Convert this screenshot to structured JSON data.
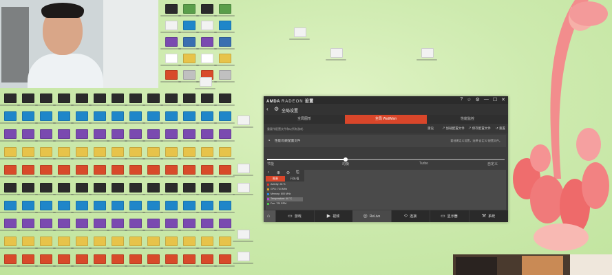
{
  "window": {
    "brand": "AMDA",
    "brand_sub": "RADEON",
    "title_suffix": "设置",
    "controls": [
      "?",
      "☆",
      "⚙",
      "—",
      "☐",
      "✕"
    ],
    "header_title": "全局设置"
  },
  "tabs": [
    "全局图形",
    "全局 WattMan",
    "性能监控"
  ],
  "options": {
    "hint": "重要作配置文件和以所有游戏.",
    "reset": "重设",
    "load": "加载配置文件",
    "save": "保存配置文件",
    "restore": "重置"
  },
  "profile": {
    "label": "性能/功耗配置文件",
    "note": "要创建定义设置，选择“自定义”配置文件。"
  },
  "slider": {
    "ticks": [
      "节能",
      "均衡",
      "Turbo",
      "自定义"
    ],
    "level": 0.33
  },
  "graph": {
    "tabs": [
      "图表",
      "开关/值"
    ],
    "legend": [
      {
        "label": "Activity: 28 %",
        "color": "#e03a2a"
      },
      {
        "label": "GPU: 744 MHz",
        "color": "#e0a22a"
      },
      {
        "label": "Memory: 800 MHz",
        "color": "#2a8ae0"
      },
      {
        "label": "Temperature: 40 °C",
        "color": "#b04ad0"
      },
      {
        "label": "Fan: 720 RPM",
        "color": "#4ac04a"
      }
    ]
  },
  "bottom_nav": [
    {
      "label": "",
      "icon": "home-icon"
    },
    {
      "label": "游戏",
      "icon": "gamepad-icon"
    },
    {
      "label": "视频",
      "icon": "play-icon"
    },
    {
      "label": "ReLive",
      "icon": "relive-icon"
    },
    {
      "label": "连接",
      "icon": "connect-icon"
    },
    {
      "label": "显示器",
      "icon": "display-icon"
    },
    {
      "label": "系统",
      "icon": "system-icon"
    }
  ]
}
